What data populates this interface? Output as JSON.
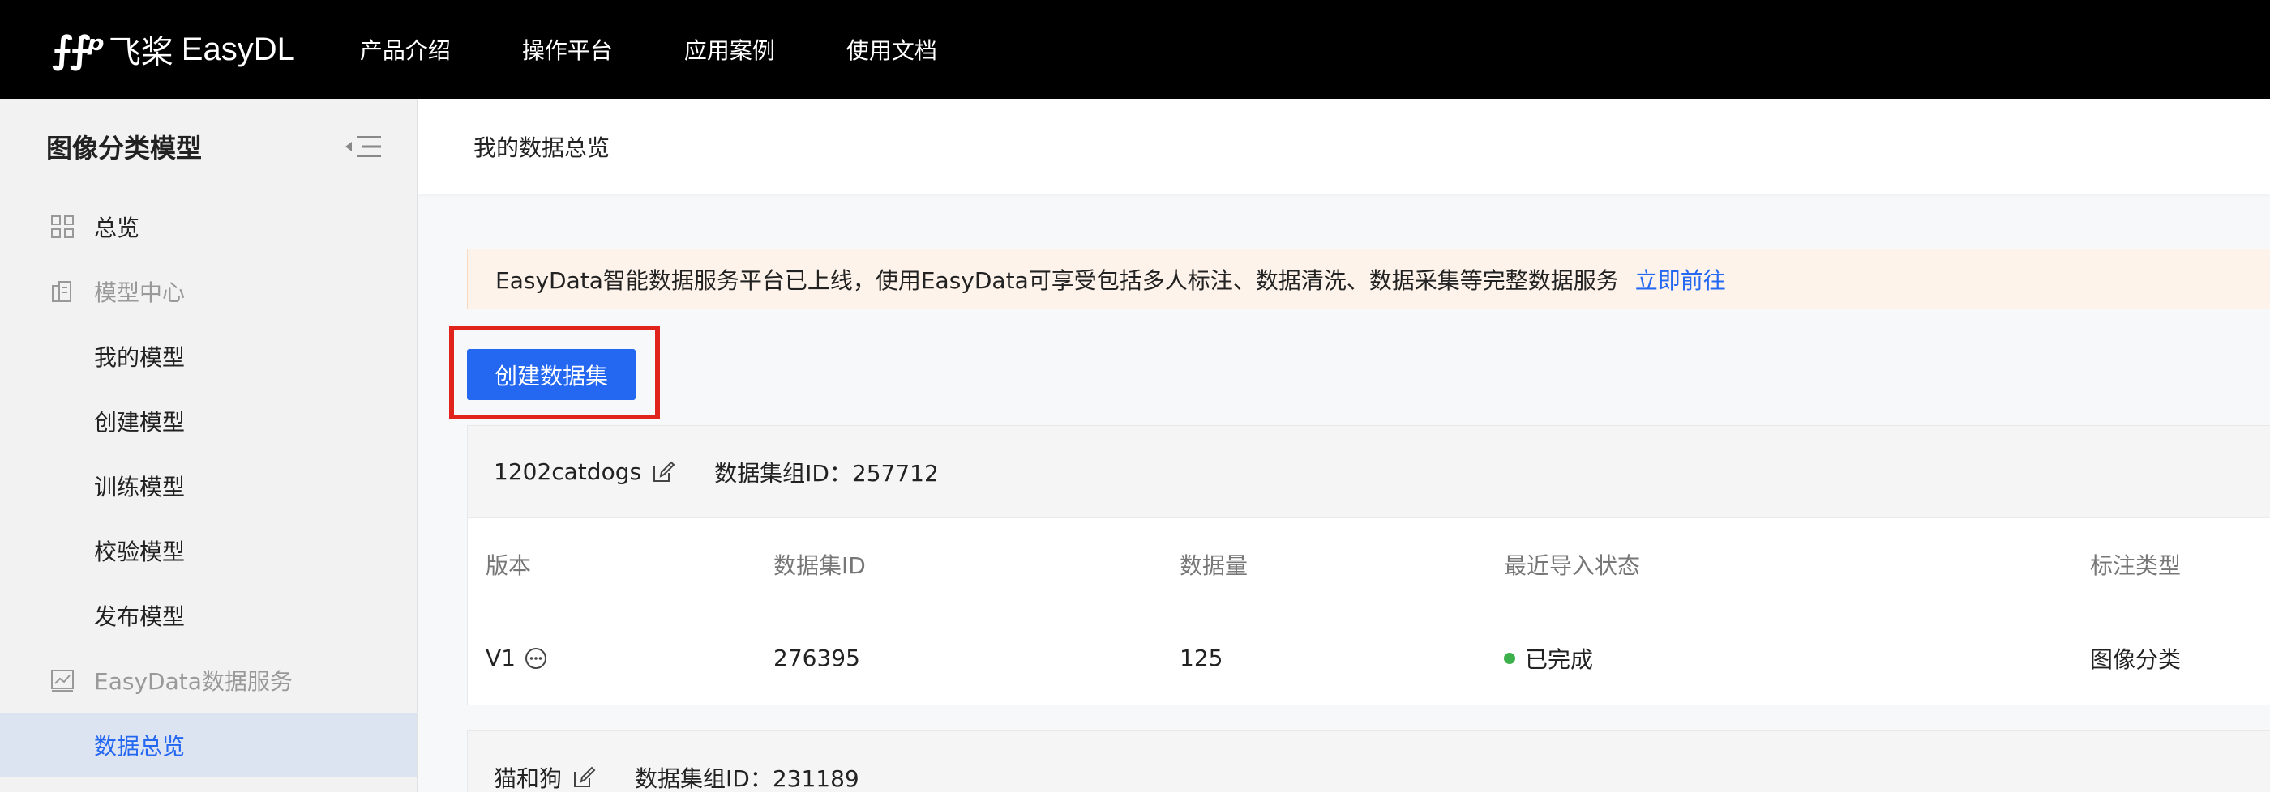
{
  "header": {
    "logo_mark": "⨍⨍ᵖ",
    "logo_cn": "飞桨",
    "logo_en": "EasyDL",
    "nav": [
      "产品介绍",
      "操作平台",
      "应用案例",
      "使用文档"
    ]
  },
  "sidebar": {
    "title": "图像分类模型",
    "items": [
      {
        "label": "总览",
        "icon": "grid-icon"
      },
      {
        "label": "模型中心",
        "icon": "building-icon"
      },
      {
        "label": "我的模型"
      },
      {
        "label": "创建模型"
      },
      {
        "label": "训练模型"
      },
      {
        "label": "校验模型"
      },
      {
        "label": "发布模型"
      },
      {
        "label": "EasyData数据服务",
        "icon": "chart-icon"
      },
      {
        "label": "数据总览"
      }
    ]
  },
  "main": {
    "breadcrumb": "我的数据总览",
    "notice": {
      "text": "EasyData智能数据服务平台已上线，使用EasyData可享受包括多人标注、数据清洗、数据采集等完整数据服务",
      "link": "立即前往"
    },
    "create_button": "创建数据集",
    "datasets": [
      {
        "name": "1202catdogs",
        "group_id": "数据集组ID：257712",
        "columns": [
          "版本",
          "数据集ID",
          "数据量",
          "最近导入状态",
          "标注类型"
        ],
        "rows": [
          {
            "version": "V1",
            "dataset_id": "276395",
            "count": "125",
            "status": "已完成",
            "label_type": "图像分类"
          }
        ]
      },
      {
        "name": "猫和狗",
        "group_id": "数据集组ID：231189"
      }
    ]
  },
  "colors": {
    "accent": "#2468f2",
    "highlight_outline": "#e0241b",
    "status_done": "#3cb04a",
    "notice_bg": "#fdf3ea"
  }
}
